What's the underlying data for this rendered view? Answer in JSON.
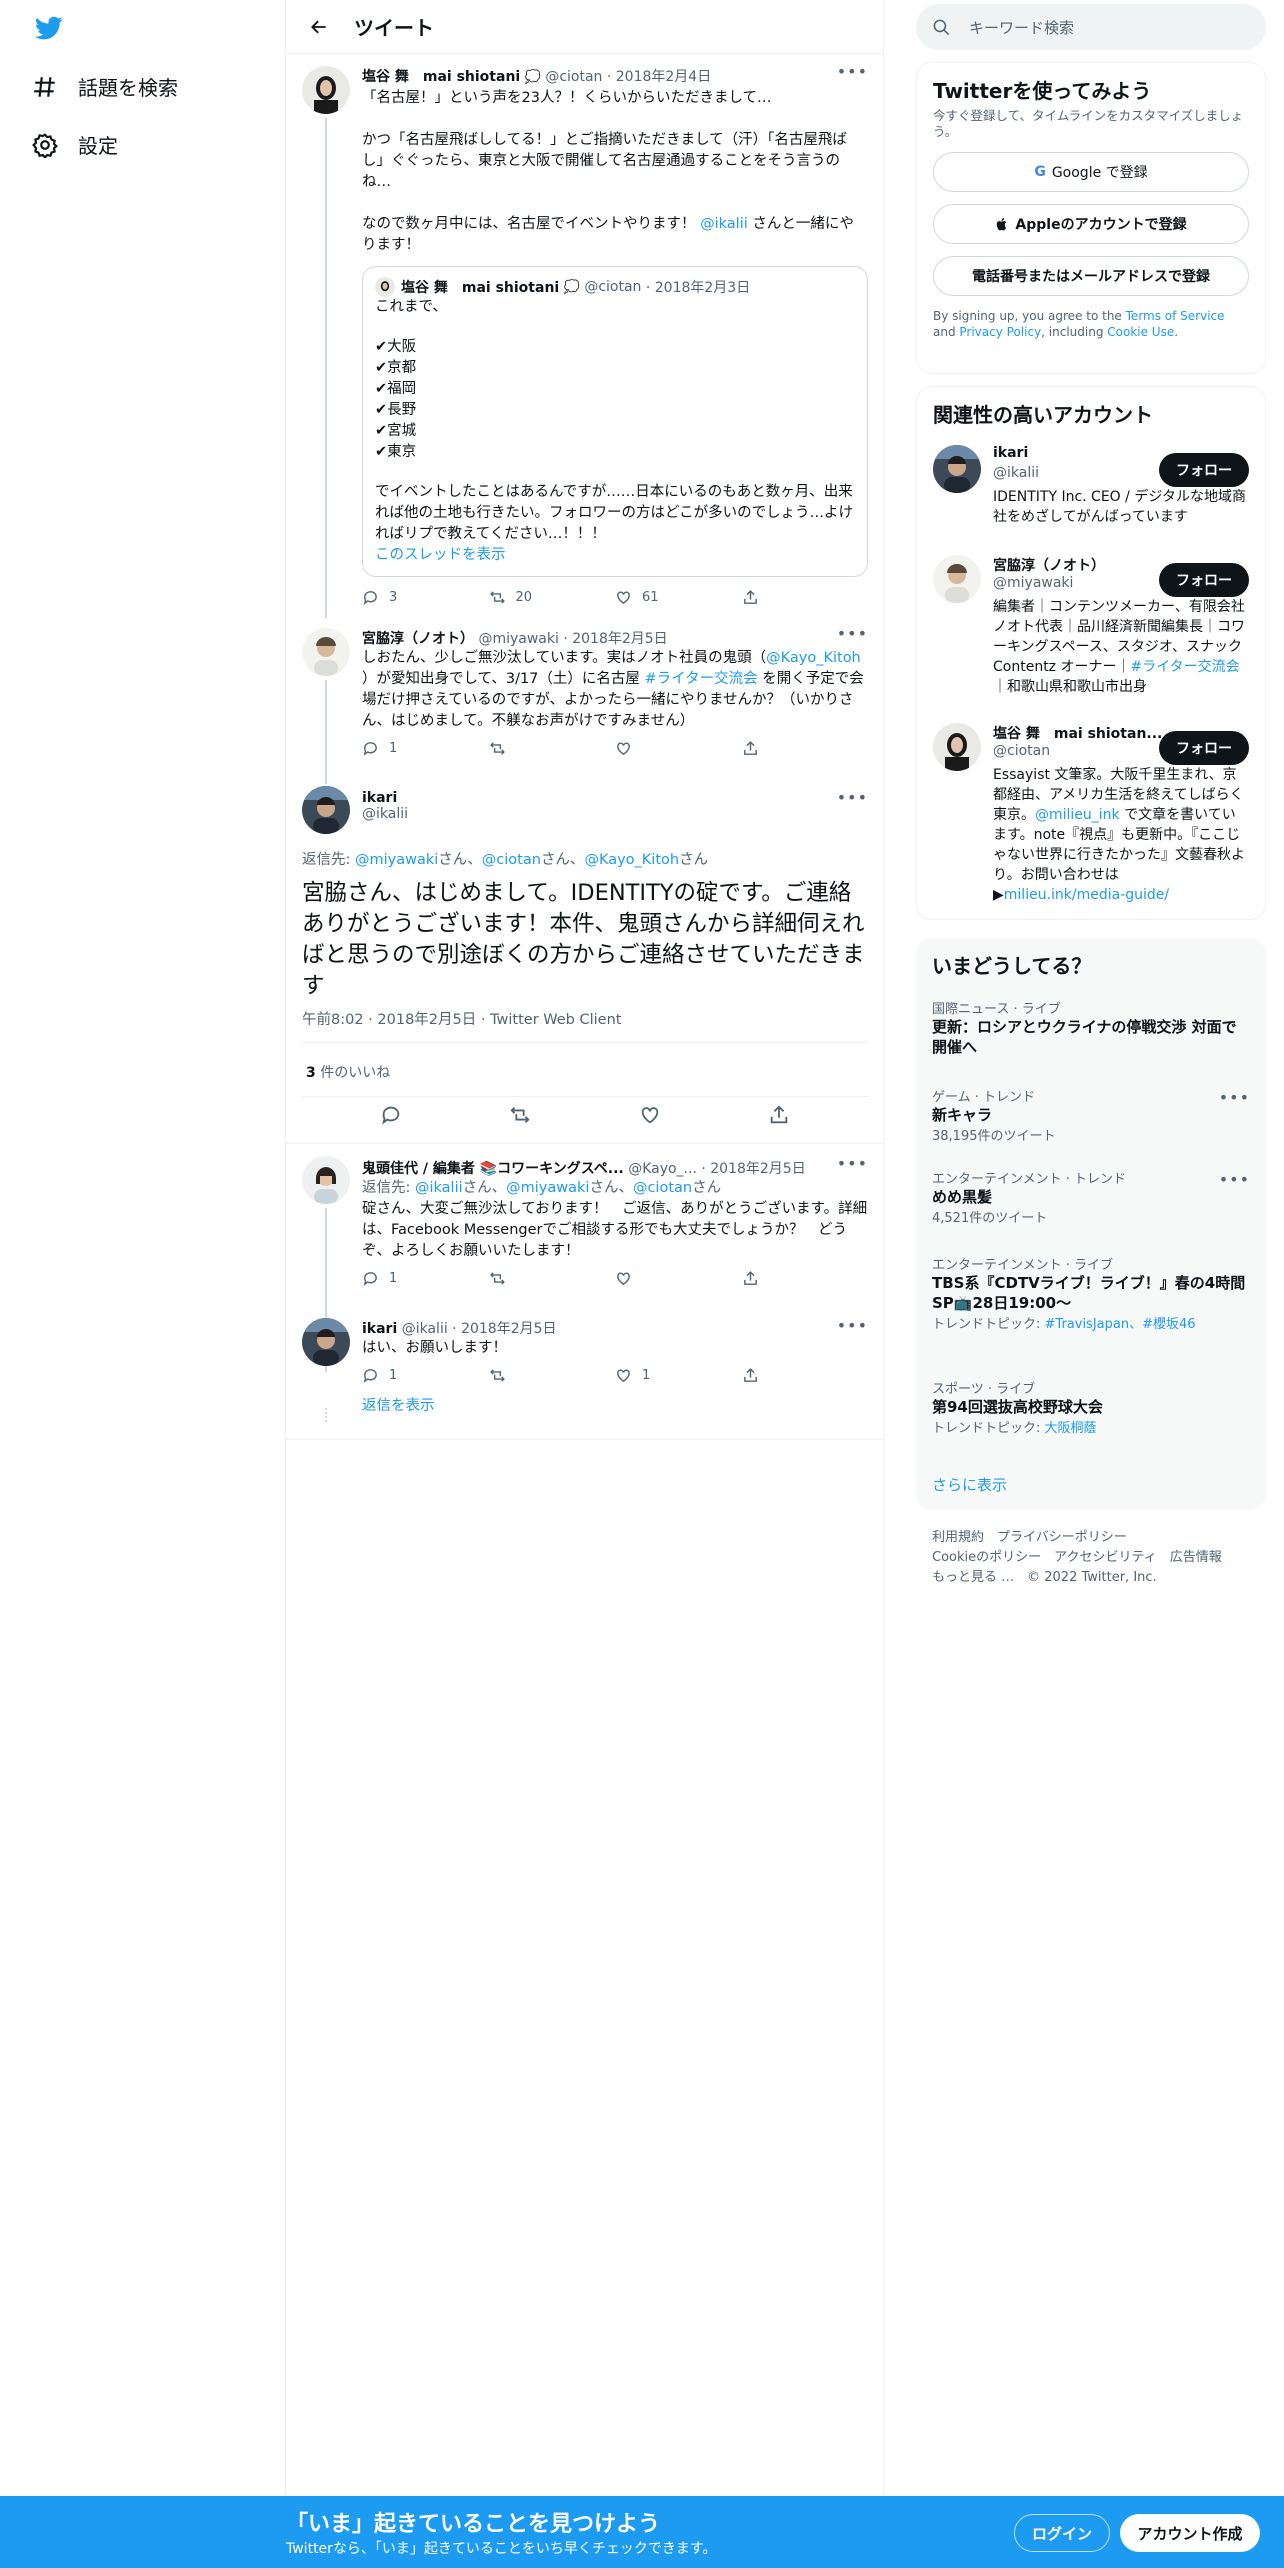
{
  "nav": {
    "explore": "話題を検索",
    "settings": "設定"
  },
  "header": {
    "title": "ツイート"
  },
  "tweet1": {
    "name": "塩谷 舞　mai shiotani",
    "handle": "@ciotan",
    "date": "· 2018年2月4日",
    "line1": "「名古屋！」という声を23人？！くらいからいただきまして…",
    "line2": "かつ「名古屋飛ばししてる！」とご指摘いただきまして（汗）「名古屋飛ばし」ぐぐったら、東京と大阪で開催して名古屋通過することをそう言うのね…",
    "line3a": "なので数ヶ月中には、名古屋でイベントやります！",
    "line3_mention": "@ikalii",
    "line3b": " さんと一緒にやります！",
    "quote": {
      "name": "塩谷 舞　mai shiotani",
      "handle": "@ciotan",
      "date": "· 2018年2月3日",
      "intro": "これまで、",
      "cities": [
        "✔大阪",
        "✔京都",
        "✔福岡",
        "✔長野",
        "✔宮城",
        "✔東京"
      ],
      "body": "でイベントしたことはあるんですが……日本にいるのもあと数ヶ月、出来れば他の土地も行きたい。フォロワーの方はどこが多いのでしょう…よければリプで教えてください…！！！",
      "show_thread": "このスレッドを表示"
    },
    "replies": "3",
    "retweets": "20",
    "likes": "61"
  },
  "tweet2": {
    "name": "宮脇淳（ノオト）",
    "handle": "@miyawaki",
    "date": "· 2018年2月5日",
    "t1": "しおたん、少しご無沙汰しています。実はノオト社員の鬼頭（",
    "mention": "@Kayo_Kitoh",
    "t2": " ）が愛知出身でして、3/17（土）に名古屋 ",
    "hashtag": "#ライター交流会",
    "t3": " を開く予定で会場だけ押さえているのですが、よかったら一緒にやりませんか？（いかりさん、はじめまして。不躾なお声がけですみません）",
    "replies": "1"
  },
  "main_tweet": {
    "name": "ikari",
    "handle": "@ikalii",
    "reply_to_label": "返信先: ",
    "reply_to_1": "@miyawaki",
    "reply_to_2": "@ciotan",
    "reply_to_3": "@Kayo_Kitoh",
    "san": "さん",
    "san_comma": "さん、",
    "text": "宮脇さん、はじめまして。IDENTITYの碇です。ご連絡ありがとうございます！本件、鬼頭さんから詳細伺えればと思うので別途ぼくの方からご連絡させていただきます",
    "timestamp": "午前8:02 · 2018年2月5日 · Twitter Web Client",
    "likes_count": "3",
    "likes_label": " 件のいいね"
  },
  "tweet4": {
    "name": "鬼頭佳代 / 編集者 📚コワーキングスペ...",
    "handle": "@Kayo_...",
    "date": "· 2018年2月5日",
    "reply_label": "返信先: ",
    "reply_1": "@ikalii",
    "reply_2": "@miyawaki",
    "reply_3": "@ciotan",
    "text": "碇さん、大変ご無沙汰しております！　ご返信、ありがとうございます。詳細は、Facebook Messengerでご相談する形でも大丈夫でしょうか？　どうぞ、よろしくお願いいたします！",
    "replies": "1"
  },
  "tweet5": {
    "name": "ikari",
    "handle": "@ikalii",
    "date": "· 2018年2月5日",
    "text": "はい、お願いします！",
    "replies": "1",
    "likes": "1",
    "show_replies": "返信を表示"
  },
  "search": {
    "placeholder": "キーワード検索"
  },
  "signup": {
    "title": "Twitterを使ってみよう",
    "subtitle": "今すぐ登録して、タイムラインをカスタマイズしましょう。",
    "google": "Google で登録",
    "apple": "Appleのアカウントで登録",
    "phone": "電話番号またはメールアドレスで登録",
    "terms_a": "By signing up, you agree to the ",
    "terms_link": "Terms of Service",
    "terms_b": " and ",
    "privacy_link": "Privacy Policy",
    "terms_c": ", including ",
    "cookie_link": "Cookie Use",
    "terms_d": "."
  },
  "related": {
    "title": "関連性の高いアカウント",
    "follow": "フォロー",
    "accounts": [
      {
        "name": "ikari",
        "handle": "@ikalii",
        "bio": "IDENTITY Inc. CEO / デジタルな地域商社をめざしてがんばっています"
      },
      {
        "name": "宮脇淳（ノオト）",
        "handle": "@miyawaki",
        "bio_a": "編集者｜コンテンツメーカー、有限会社ノオト代表｜品川経済新聞編集長｜コワーキングスペース、スタジオ、スナック Contentz オーナー｜",
        "bio_tag": "#ライター交流会",
        "bio_b": " ｜和歌山県和歌山市出身"
      },
      {
        "name": "塩谷 舞　mai shiotan...",
        "handle": "@ciotan",
        "bio_a": "Essayist 文筆家。大阪千里生まれ、京都経由、アメリカ生活を終えてしばらく東京。",
        "bio_mention": "@milieu_ink",
        "bio_b": " で文章を書いています。note『視点』も更新中。『ここじゃない世界に行きたかった』文藝春秋より。お問い合わせは▶",
        "bio_link": "milieu.ink/media-guide/"
      }
    ]
  },
  "trends": {
    "title": "いまどうしてる？",
    "items": [
      {
        "cat": "国際ニュース · ライブ",
        "title": "更新：ロシアとウクライナの停戦交渉 対面で開催へ",
        "sub": ""
      },
      {
        "cat": "ゲーム · トレンド",
        "title": "新キャラ",
        "sub": "38,195件のツイート"
      },
      {
        "cat": "エンターテインメント · トレンド",
        "title": "めめ黒髪",
        "sub": "4,521件のツイート"
      },
      {
        "cat": "エンターテインメント · ライブ",
        "title": "TBS系『CDTVライブ！ライブ！』春の4時間SP📺28日19:00〜",
        "sub_label": "トレンドトピック: ",
        "sub_link": "#TravisJapan、#櫻坂46"
      },
      {
        "cat": "スポーツ · ライブ",
        "title": "第94回選抜高校野球大会",
        "sub_label": "トレンドトピック: ",
        "sub_link": "大阪桐蔭"
      }
    ],
    "more": "さらに表示"
  },
  "footer": {
    "row1": "利用規約　プライバシーポリシー",
    "row2": "Cookieのポリシー　アクセシビリティ　広告情報",
    "row3": "もっと見る …　© 2022 Twitter, Inc."
  },
  "bottom_bar": {
    "title": "「いま」起きていることを見つけよう",
    "subtitle": "Twitterなら、「いま」起きていることをいち早くチェックできます。",
    "login": "ログイン",
    "signup": "アカウント作成"
  },
  "colors": {
    "accent": "#1d9bf0",
    "text": "#0f1419",
    "muted": "#536471",
    "dark_button": "#0f1419"
  }
}
